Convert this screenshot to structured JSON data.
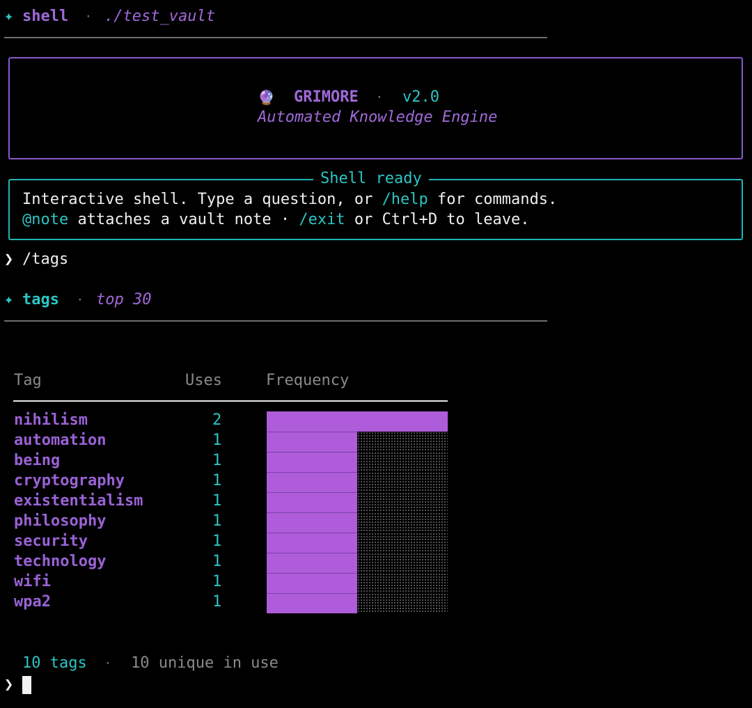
{
  "header": {
    "bullet": "✦",
    "title": "shell",
    "sep": "·",
    "path": "./test_vault"
  },
  "banner": {
    "icon": "crystal-ball-icon",
    "emoji": "🔮",
    "name": "GRIMORE",
    "sep": "·",
    "version": "v2.0",
    "subtitle": "Automated Knowledge Engine",
    "border_color": "#8a58d0"
  },
  "ready_panel": {
    "title": "Shell ready",
    "line1_a": "Interactive shell. Type a question, or ",
    "line1_cmd": "/help",
    "line1_b": " for commands.",
    "line2_cmd": "@note",
    "line2_a": " attaches a vault note · ",
    "line2_cmd2": "/exit",
    "line2_b": " or Ctrl+D to leave.",
    "border_color": "#1fb6b6"
  },
  "prompt1": {
    "symbol": "❯",
    "command": "/tags"
  },
  "tags_header": {
    "bullet": "✦",
    "title": "tags",
    "sep": "·",
    "subtitle": "top 30"
  },
  "table": {
    "headers": {
      "tag": "Tag",
      "uses": "Uses",
      "freq": "Frequency"
    },
    "max_uses": 2,
    "rows": [
      {
        "tag": "nihilism",
        "uses": 2
      },
      {
        "tag": "automation",
        "uses": 1
      },
      {
        "tag": "being",
        "uses": 1
      },
      {
        "tag": "cryptography",
        "uses": 1
      },
      {
        "tag": "existentialism",
        "uses": 1
      },
      {
        "tag": "philosophy",
        "uses": 1
      },
      {
        "tag": "security",
        "uses": 1
      },
      {
        "tag": "technology",
        "uses": 1
      },
      {
        "tag": "wifi",
        "uses": 1
      },
      {
        "tag": "wpa2",
        "uses": 1
      }
    ]
  },
  "summary": {
    "count": "10 tags",
    "sep": "·",
    "unique": "10 unique in use"
  },
  "prompt2": {
    "symbol": "❯"
  },
  "colors": {
    "accent_cyan": "#2ec4c4",
    "accent_purple": "#a06ad8",
    "bar_fill": "#ae5cda"
  }
}
